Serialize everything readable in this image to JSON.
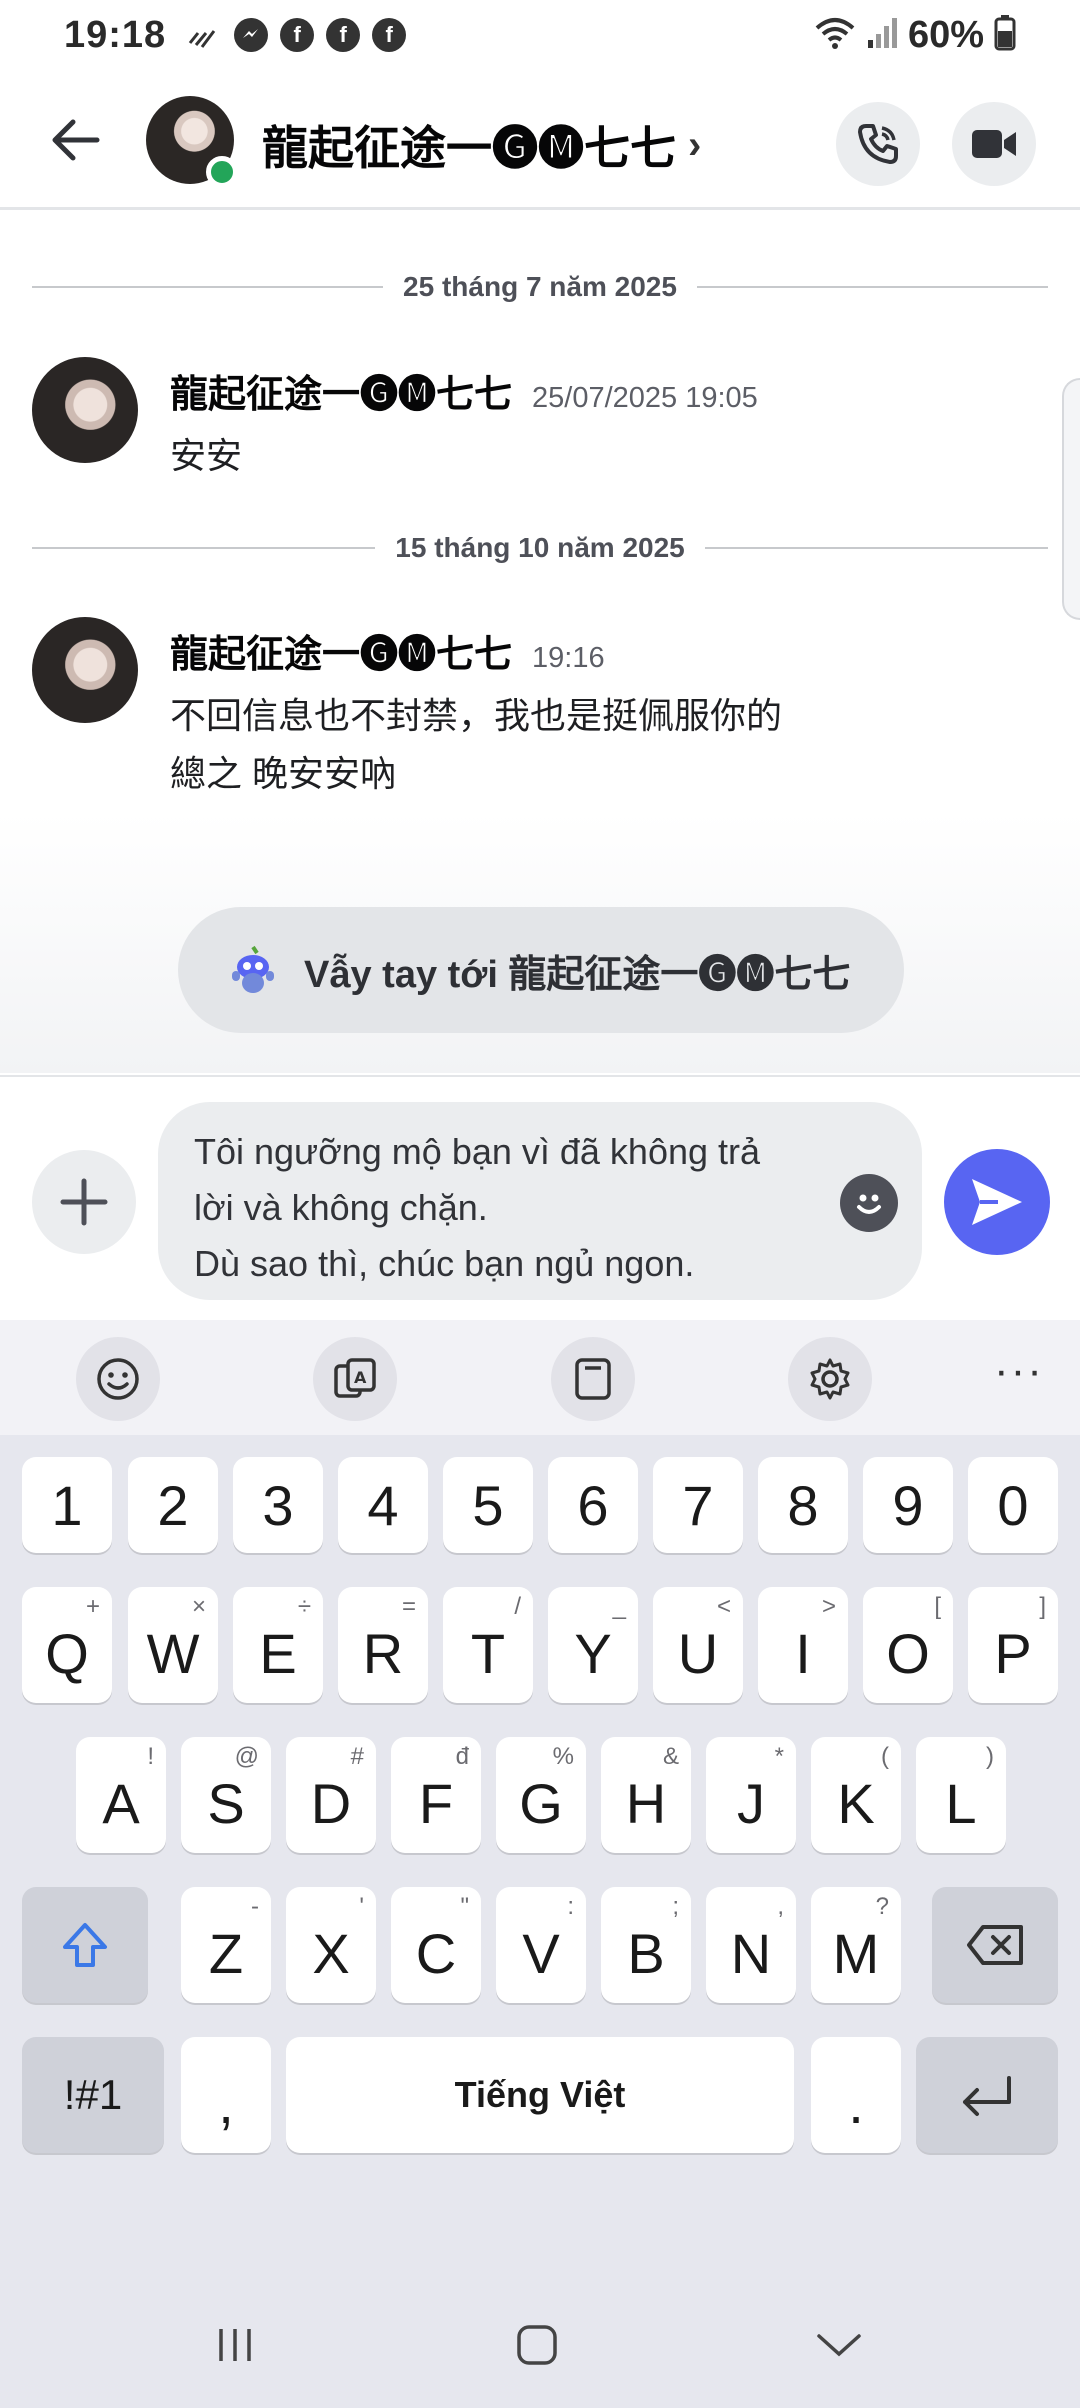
{
  "status_bar": {
    "time": "19:18",
    "battery": "60%"
  },
  "header": {
    "contact_name": "龍起征途一🅖🅜七七",
    "chevron": "›"
  },
  "messages": {
    "dividers": [
      "25 tháng 7 năm 2025",
      "15 tháng 10 năm 2025"
    ],
    "items": [
      {
        "author": "龍起征途一🅖🅜七七",
        "time": "25/07/2025 19:05",
        "text": "安安"
      },
      {
        "author": "龍起征途一🅖🅜七七",
        "time": "19:16",
        "text": "不回信息也不封禁，我也是挺佩服你的\n總之 晚安安吶"
      }
    ]
  },
  "wave": {
    "label": "Vẫy tay tới 龍起征途一🅖🅜七七"
  },
  "composer": {
    "text": "Tôi ngưỡng mộ bạn vì đã không trả\nlời và không chặn.\nDù sao thì, chúc bạn ngủ ngon."
  },
  "keyboard": {
    "more_label": "···",
    "numbers": [
      "1",
      "2",
      "3",
      "4",
      "5",
      "6",
      "7",
      "8",
      "9",
      "0"
    ],
    "row1": [
      {
        "k": "Q",
        "h": "+"
      },
      {
        "k": "W",
        "h": "×"
      },
      {
        "k": "E",
        "h": "÷"
      },
      {
        "k": "R",
        "h": "="
      },
      {
        "k": "T",
        "h": "/"
      },
      {
        "k": "Y",
        "h": "_"
      },
      {
        "k": "U",
        "h": "<"
      },
      {
        "k": "I",
        "h": ">"
      },
      {
        "k": "O",
        "h": "["
      },
      {
        "k": "P",
        "h": "]"
      }
    ],
    "row2": [
      {
        "k": "A",
        "h": "!"
      },
      {
        "k": "S",
        "h": "@"
      },
      {
        "k": "D",
        "h": "#"
      },
      {
        "k": "F",
        "h": "đ"
      },
      {
        "k": "G",
        "h": "%"
      },
      {
        "k": "H",
        "h": "&"
      },
      {
        "k": "J",
        "h": "*"
      },
      {
        "k": "K",
        "h": "("
      },
      {
        "k": "L",
        "h": ")"
      }
    ],
    "row3": [
      {
        "k": "Z",
        "h": "-"
      },
      {
        "k": "X",
        "h": "'"
      },
      {
        "k": "C",
        "h": "\""
      },
      {
        "k": "V",
        "h": ":"
      },
      {
        "k": "B",
        "h": ";"
      },
      {
        "k": "N",
        "h": ","
      },
      {
        "k": "M",
        "h": "?"
      }
    ],
    "symbols_label": "!#1",
    "comma_label": ",",
    "space_label": "Tiếng Việt",
    "period_label": "."
  },
  "icons": {
    "back": "arrow-left-icon",
    "call": "phone-icon",
    "video": "video-camera-icon",
    "attach": "plus-icon",
    "emoji": "emoji-icon",
    "send": "send-icon",
    "accent_color": "#5865f2",
    "online_color": "#23a559"
  }
}
